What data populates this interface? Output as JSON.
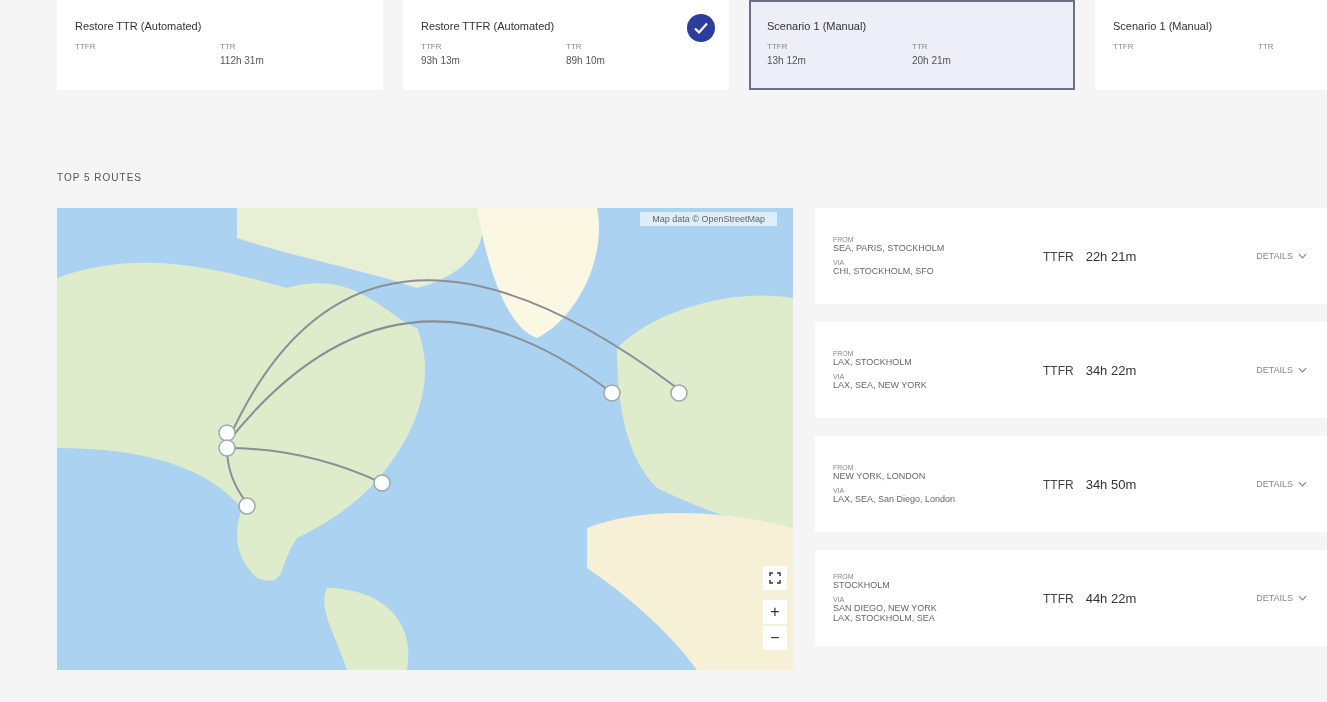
{
  "scenarios": [
    {
      "title": "Restore TTR (Automated)",
      "selected": false,
      "checked": false,
      "fields": [
        {
          "label": "TTFR"
        },
        {
          "label": "TTR",
          "value": "112h 31m"
        }
      ]
    },
    {
      "title": "Restore TTFR (Automated)",
      "selected": false,
      "checked": true,
      "fields": [
        {
          "label": "TTFR",
          "value": "93h 13m"
        },
        {
          "label": "TTR",
          "value": "89h 10m"
        }
      ]
    },
    {
      "title": "Scenario 1 (Manual)",
      "selected": true,
      "checked": false,
      "fields": [
        {
          "label": "TTFR",
          "value": "13h 12m"
        },
        {
          "label": "TTR",
          "value": "20h 21m"
        }
      ]
    },
    {
      "title": "Scenario 1 (Manual)",
      "selected": false,
      "checked": false,
      "fields": [
        {
          "label": "TTFR"
        },
        {
          "label": "TTR"
        }
      ]
    }
  ],
  "section_title": "TOP 5 ROUTES",
  "map": {
    "attribution": "Map data © OpenStreetMap",
    "zoom_in": "+",
    "zoom_out": "−"
  },
  "routes": [
    {
      "from_label": "FROM",
      "from": "SEA, PARIS, STOCKHOLM",
      "via_label": "VIA",
      "via": [
        "CHI, STOCKHOLM, SFO"
      ],
      "metric": "TTFR",
      "time": "22h 21m",
      "action": "DETAILS"
    },
    {
      "from_label": "FROM",
      "from": "LAX, STOCKHOLM",
      "via_label": "VIA",
      "via": [
        "LAX, SEA, NEW YORK"
      ],
      "metric": "TTFR",
      "time": "34h 22m",
      "action": "DETAILS"
    },
    {
      "from_label": "FROM",
      "from": "NEW YORK, LONDON",
      "via_label": "VIA",
      "via": [
        "LAX, SEA, San Diego, London"
      ],
      "metric": "TTFR",
      "time": "34h 50m",
      "action": "DETAILS"
    },
    {
      "from_label": "FROM",
      "from": "STOCKHOLM",
      "via_label": "VIA",
      "via": [
        "SAN DIEGO, NEW YORK",
        "LAX, STOCKHOLM, SEA"
      ],
      "metric": "TTFR",
      "time": "44h 22m",
      "action": "DETAILS"
    }
  ]
}
